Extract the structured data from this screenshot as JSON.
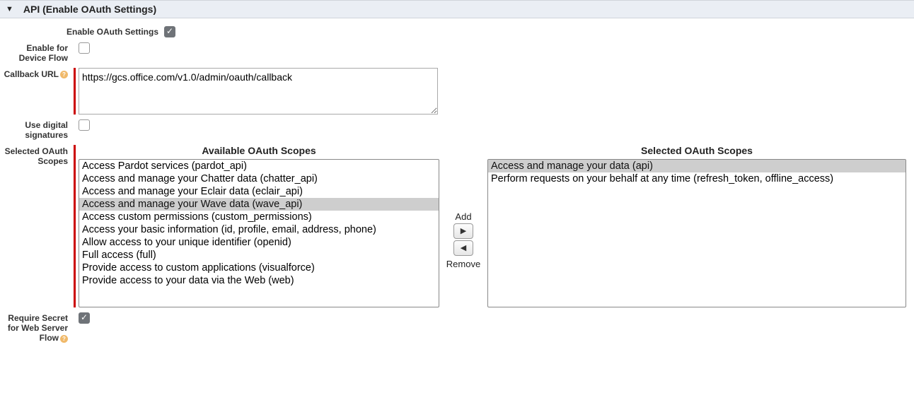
{
  "section": {
    "title": "API (Enable OAuth Settings)"
  },
  "labels": {
    "enable_oauth": "Enable OAuth Settings",
    "enable_device_flow": "Enable for Device Flow",
    "callback_url": "Callback URL",
    "use_digital_sig": "Use digital signatures",
    "selected_scopes": "Selected OAuth Scopes",
    "require_secret": "Require Secret for Web Server Flow"
  },
  "values": {
    "callback_url": "https://gcs.office.com/v1.0/admin/oauth/callback"
  },
  "scopes": {
    "available_heading": "Available OAuth Scopes",
    "selected_heading": "Selected OAuth Scopes",
    "add_label": "Add",
    "remove_label": "Remove",
    "available": [
      "Access Pardot services (pardot_api)",
      "Access and manage your Chatter data (chatter_api)",
      "Access and manage your Eclair data (eclair_api)",
      "Access and manage your Wave data (wave_api)",
      "Access custom permissions (custom_permissions)",
      "Access your basic information (id, profile, email, address, phone)",
      "Allow access to your unique identifier (openid)",
      "Full access (full)",
      "Provide access to custom applications (visualforce)",
      "Provide access to your data via the Web (web)"
    ],
    "available_selected_index": 3,
    "selected": [
      "Access and manage your data (api)",
      "Perform requests on your behalf at any time (refresh_token, offline_access)"
    ],
    "selected_selected_index": 0
  }
}
